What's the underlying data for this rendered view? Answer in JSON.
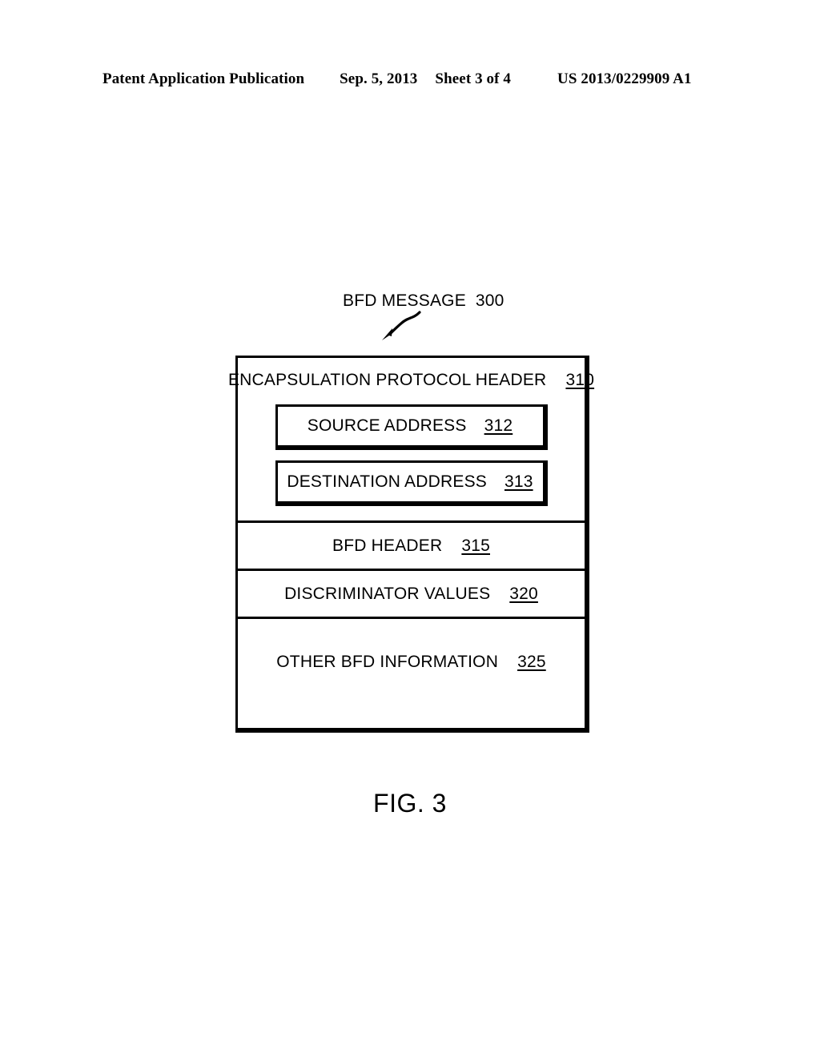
{
  "page_header": {
    "publication": "Patent Application Publication",
    "date": "Sep. 5, 2013",
    "sheet": "Sheet 3 of 4",
    "document_number": "US 2013/0229909 A1"
  },
  "figure": {
    "caption": "FIG. 3",
    "callout": {
      "label": "BFD MESSAGE",
      "ref": "300"
    },
    "message_box": {
      "sections": [
        {
          "label": "ENCAPSULATION PROTOCOL HEADER",
          "ref": "310",
          "children": [
            {
              "label": "SOURCE ADDRESS",
              "ref": "312"
            },
            {
              "label": "DESTINATION ADDRESS",
              "ref": "313"
            }
          ]
        },
        {
          "label": "BFD HEADER",
          "ref": "315"
        },
        {
          "label": "DISCRIMINATOR VALUES",
          "ref": "320"
        },
        {
          "label": "OTHER BFD INFORMATION",
          "ref": "325"
        }
      ]
    }
  },
  "colors": {
    "ink": "#000000",
    "paper": "#ffffff"
  }
}
